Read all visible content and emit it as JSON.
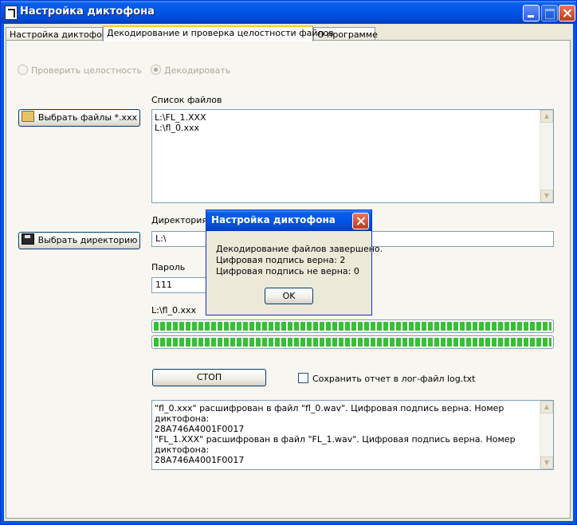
{
  "window": {
    "title": "Настройка диктофона"
  },
  "tabs": [
    {
      "label": "Настройка диктофона"
    },
    {
      "label": "Декодирование и проверка целостности файлов"
    },
    {
      "label": "О программе"
    }
  ],
  "mode": {
    "option_verify": "Проверить целостность",
    "option_decode": "Декодировать",
    "selected": "Декодировать"
  },
  "files": {
    "select_button": "Выбрать файлы *.xxx",
    "list_label": "Список файлов",
    "items": [
      "L:\\FL_1.XXX",
      "L:\\fl_0.xxx"
    ]
  },
  "directory": {
    "label": "Директория д",
    "select_button": "Выбрать директорию",
    "value": "L:\\"
  },
  "password": {
    "label": "Пароль",
    "value": "111"
  },
  "progress": {
    "current_file": "L:\\fl_0.xxx",
    "bar1": 1.0,
    "bar2": 1.0
  },
  "actions": {
    "stop_button": "СТОП",
    "save_log_label": "Сохранить отчет в лог-файл log.txt",
    "save_log_checked": false
  },
  "log": {
    "lines": [
      "\"fl_0.xxx\" расшифрован в файл \"fl_0.wav\". Цифровая подпись верна. Номер диктофона:",
      "28A746A4001F0017",
      "\"FL_1.XXX\" расшифрован в файл \"FL_1.wav\". Цифровая подпись верна. Номер диктофона:",
      "28A746A4001F0017"
    ]
  },
  "dialog": {
    "title": "Настройка диктофона",
    "message_line1": "Декодирование файлов завершено.",
    "message_line2": "Цифровая подпись верна: 2",
    "message_line3": "Цифровая подпись не верна: 0",
    "ok_button": "OK"
  }
}
